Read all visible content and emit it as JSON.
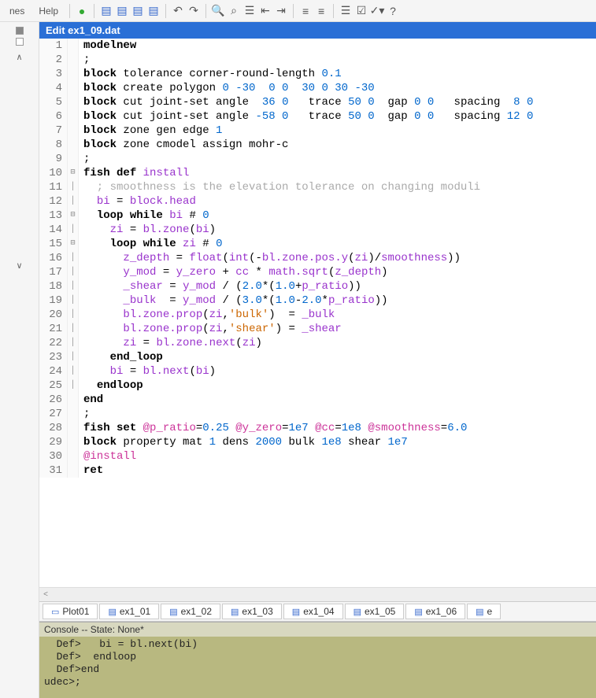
{
  "menu": {
    "panes": "nes",
    "help": "Help"
  },
  "title": "Edit ex1_09.dat",
  "tabs": [
    {
      "label": "Plot01"
    },
    {
      "label": "ex1_01"
    },
    {
      "label": "ex1_02"
    },
    {
      "label": "ex1_03"
    },
    {
      "label": "ex1_04"
    },
    {
      "label": "ex1_05"
    },
    {
      "label": "ex1_06"
    },
    {
      "label": "e"
    }
  ],
  "console_header": "Console -- State: None*",
  "console_lines": [
    "  Def>   bi = bl.next(bi)",
    "  Def>  endloop",
    "  Def>end",
    "udec>;"
  ],
  "code": [
    {
      "n": 1,
      "fold": "",
      "tokens": [
        [
          "kw",
          "model"
        ],
        [
          "",
          ""
        ],
        [
          "kw",
          "new"
        ]
      ]
    },
    {
      "n": 2,
      "fold": "",
      "tokens": [
        [
          "",
          "; "
        ]
      ]
    },
    {
      "n": 3,
      "fold": "",
      "tokens": [
        [
          "kw",
          "block"
        ],
        [
          "",
          " tolerance corner-round-length "
        ],
        [
          "num",
          "0.1"
        ]
      ]
    },
    {
      "n": 4,
      "fold": "",
      "tokens": [
        [
          "kw",
          "block"
        ],
        [
          "",
          " create polygon "
        ],
        [
          "num",
          "0 -30  0 0  30 0 30 -30"
        ]
      ]
    },
    {
      "n": 5,
      "fold": "",
      "tokens": [
        [
          "kw",
          "block"
        ],
        [
          "",
          " cut joint-set angle  "
        ],
        [
          "num",
          "36 0"
        ],
        [
          "",
          "   trace "
        ],
        [
          "num",
          "50 0"
        ],
        [
          "",
          "  gap "
        ],
        [
          "num",
          "0 0"
        ],
        [
          "",
          "   spacing  "
        ],
        [
          "num",
          "8 0"
        ]
      ]
    },
    {
      "n": 6,
      "fold": "",
      "tokens": [
        [
          "kw",
          "block"
        ],
        [
          "",
          " cut joint-set angle "
        ],
        [
          "num",
          "-58 0"
        ],
        [
          "",
          "   trace "
        ],
        [
          "num",
          "50 0"
        ],
        [
          "",
          "  gap "
        ],
        [
          "num",
          "0 0"
        ],
        [
          "",
          "   spacing "
        ],
        [
          "num",
          "12 0"
        ]
      ]
    },
    {
      "n": 7,
      "fold": "",
      "tokens": [
        [
          "kw",
          "block"
        ],
        [
          "",
          " zone gen edge "
        ],
        [
          "num",
          "1"
        ]
      ]
    },
    {
      "n": 8,
      "fold": "",
      "tokens": [
        [
          "kw",
          "block"
        ],
        [
          "",
          " zone cmodel assign mohr-c"
        ]
      ]
    },
    {
      "n": 9,
      "fold": "",
      "tokens": [
        [
          "",
          "; "
        ]
      ]
    },
    {
      "n": 10,
      "fold": "⊟",
      "tokens": [
        [
          "kw",
          "fish"
        ],
        [
          "",
          " "
        ],
        [
          "kw",
          "def"
        ],
        [
          "",
          " "
        ],
        [
          "fn",
          "install"
        ]
      ]
    },
    {
      "n": 11,
      "fold": "│",
      "tokens": [
        [
          "cm",
          "  ; smoothness is the elevation tolerance on changing moduli"
        ]
      ]
    },
    {
      "n": 12,
      "fold": "│",
      "tokens": [
        [
          "",
          "  "
        ],
        [
          "fn",
          "bi"
        ],
        [
          "",
          " = "
        ],
        [
          "fn",
          "block.head"
        ]
      ]
    },
    {
      "n": 13,
      "fold": "⊟",
      "tokens": [
        [
          "",
          "  "
        ],
        [
          "kw",
          "loop"
        ],
        [
          "",
          " "
        ],
        [
          "kw",
          "while"
        ],
        [
          "",
          " "
        ],
        [
          "fn",
          "bi"
        ],
        [
          "",
          " # "
        ],
        [
          "num",
          "0"
        ]
      ]
    },
    {
      "n": 14,
      "fold": "│",
      "tokens": [
        [
          "",
          "    "
        ],
        [
          "fn",
          "zi"
        ],
        [
          "",
          " = "
        ],
        [
          "fn",
          "bl.zone"
        ],
        [
          "",
          "("
        ],
        [
          "fn",
          "bi"
        ],
        [
          "",
          ")"
        ]
      ]
    },
    {
      "n": 15,
      "fold": "⊟",
      "tokens": [
        [
          "",
          "    "
        ],
        [
          "kw",
          "loop"
        ],
        [
          "",
          " "
        ],
        [
          "kw",
          "while"
        ],
        [
          "",
          " "
        ],
        [
          "fn",
          "zi"
        ],
        [
          "",
          " # "
        ],
        [
          "num",
          "0"
        ]
      ]
    },
    {
      "n": 16,
      "fold": "│",
      "tokens": [
        [
          "",
          "      "
        ],
        [
          "fn",
          "z_depth"
        ],
        [
          "",
          " = "
        ],
        [
          "fn",
          "float"
        ],
        [
          "",
          "("
        ],
        [
          "fn",
          "int"
        ],
        [
          "",
          "(-"
        ],
        [
          "fn",
          "bl.zone.pos.y"
        ],
        [
          "",
          "("
        ],
        [
          "fn",
          "zi"
        ],
        [
          "",
          ")/"
        ],
        [
          "fn",
          "smoothness"
        ],
        [
          "",
          "))"
        ]
      ]
    },
    {
      "n": 17,
      "fold": "│",
      "tokens": [
        [
          "",
          "      "
        ],
        [
          "fn",
          "y_mod"
        ],
        [
          "",
          " = "
        ],
        [
          "fn",
          "y_zero"
        ],
        [
          "",
          " + "
        ],
        [
          "fn",
          "cc"
        ],
        [
          "",
          " * "
        ],
        [
          "fn",
          "math.sqrt"
        ],
        [
          "",
          "("
        ],
        [
          "fn",
          "z_depth"
        ],
        [
          "",
          ")"
        ]
      ]
    },
    {
      "n": 18,
      "fold": "│",
      "tokens": [
        [
          "",
          "      "
        ],
        [
          "fn",
          "_shear"
        ],
        [
          "",
          " = "
        ],
        [
          "fn",
          "y_mod"
        ],
        [
          "",
          " / ("
        ],
        [
          "num",
          "2.0"
        ],
        [
          "",
          "*("
        ],
        [
          "num",
          "1.0"
        ],
        [
          "",
          "+"
        ],
        [
          "fn",
          "p_ratio"
        ],
        [
          "",
          "))"
        ]
      ]
    },
    {
      "n": 19,
      "fold": "│",
      "tokens": [
        [
          "",
          "      "
        ],
        [
          "fn",
          "_bulk"
        ],
        [
          "",
          "  = "
        ],
        [
          "fn",
          "y_mod"
        ],
        [
          "",
          " / ("
        ],
        [
          "num",
          "3.0"
        ],
        [
          "",
          "*("
        ],
        [
          "num",
          "1.0"
        ],
        [
          "",
          "-"
        ],
        [
          "num",
          "2.0"
        ],
        [
          "",
          "*"
        ],
        [
          "fn",
          "p_ratio"
        ],
        [
          "",
          "))"
        ]
      ]
    },
    {
      "n": 20,
      "fold": "│",
      "tokens": [
        [
          "",
          "      "
        ],
        [
          "fn",
          "bl.zone.prop"
        ],
        [
          "",
          "("
        ],
        [
          "fn",
          "zi"
        ],
        [
          "",
          ","
        ],
        [
          "str",
          "'bulk'"
        ],
        [
          "",
          ")  = "
        ],
        [
          "fn",
          "_bulk"
        ]
      ]
    },
    {
      "n": 21,
      "fold": "│",
      "tokens": [
        [
          "",
          "      "
        ],
        [
          "fn",
          "bl.zone.prop"
        ],
        [
          "",
          "("
        ],
        [
          "fn",
          "zi"
        ],
        [
          "",
          ","
        ],
        [
          "str",
          "'shear'"
        ],
        [
          "",
          ") = "
        ],
        [
          "fn",
          "_shear"
        ]
      ]
    },
    {
      "n": 22,
      "fold": "│",
      "tokens": [
        [
          "",
          "      "
        ],
        [
          "fn",
          "zi"
        ],
        [
          "",
          " = "
        ],
        [
          "fn",
          "bl.zone.next"
        ],
        [
          "",
          "("
        ],
        [
          "fn",
          "zi"
        ],
        [
          "",
          ")"
        ]
      ]
    },
    {
      "n": 23,
      "fold": "│",
      "tokens": [
        [
          "",
          "    "
        ],
        [
          "kw",
          "end_loop"
        ]
      ]
    },
    {
      "n": 24,
      "fold": "│",
      "tokens": [
        [
          "",
          "    "
        ],
        [
          "fn",
          "bi"
        ],
        [
          "",
          " = "
        ],
        [
          "fn",
          "bl.next"
        ],
        [
          "",
          "("
        ],
        [
          "fn",
          "bi"
        ],
        [
          "",
          ")"
        ]
      ]
    },
    {
      "n": 25,
      "fold": "│",
      "tokens": [
        [
          "",
          "  "
        ],
        [
          "kw",
          "endloop"
        ]
      ]
    },
    {
      "n": 26,
      "fold": "",
      "tokens": [
        [
          "kw",
          "end"
        ]
      ]
    },
    {
      "n": 27,
      "fold": "",
      "tokens": [
        [
          "",
          "; "
        ]
      ]
    },
    {
      "n": 28,
      "fold": "",
      "tokens": [
        [
          "kw",
          "fish"
        ],
        [
          "",
          " "
        ],
        [
          "kw",
          "set"
        ],
        [
          "",
          " "
        ],
        [
          "at",
          "@p_ratio"
        ],
        [
          "",
          "="
        ],
        [
          "num",
          "0.25"
        ],
        [
          "",
          " "
        ],
        [
          "at",
          "@y_zero"
        ],
        [
          "",
          "="
        ],
        [
          "num",
          "1e7"
        ],
        [
          "",
          " "
        ],
        [
          "at",
          "@cc"
        ],
        [
          "",
          "="
        ],
        [
          "num",
          "1e8"
        ],
        [
          "",
          " "
        ],
        [
          "at",
          "@smoothness"
        ],
        [
          "",
          "="
        ],
        [
          "num",
          "6.0"
        ]
      ]
    },
    {
      "n": 29,
      "fold": "",
      "tokens": [
        [
          "kw",
          "block"
        ],
        [
          "",
          " property mat "
        ],
        [
          "num",
          "1"
        ],
        [
          "",
          " dens "
        ],
        [
          "num",
          "2000"
        ],
        [
          "",
          " bulk "
        ],
        [
          "num",
          "1e8"
        ],
        [
          "",
          " shear "
        ],
        [
          "num",
          "1e7"
        ]
      ]
    },
    {
      "n": 30,
      "fold": "",
      "tokens": [
        [
          "at",
          "@install"
        ]
      ]
    },
    {
      "n": 31,
      "fold": "",
      "tokens": [
        [
          "kw",
          "ret"
        ]
      ]
    }
  ]
}
